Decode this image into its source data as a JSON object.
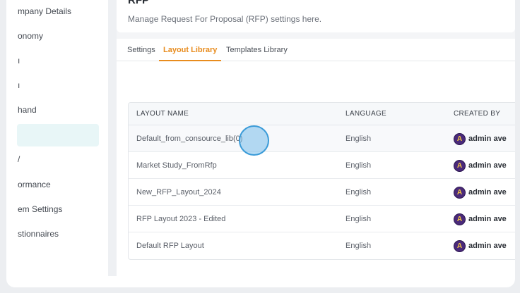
{
  "sidebar": {
    "items": [
      {
        "label": "mpany Details"
      },
      {
        "label": "onomy"
      },
      {
        "label": "ı"
      },
      {
        "label": "ı"
      },
      {
        "label": "hand"
      },
      {
        "label": ""
      },
      {
        "label": "/"
      },
      {
        "label": "ormance"
      },
      {
        "label": "em Settings"
      },
      {
        "label": "stionnaires"
      }
    ]
  },
  "header": {
    "title": "RFP",
    "subtitle": "Manage Request For Proposal (RFP) settings here."
  },
  "tabs": [
    {
      "label": "Settings"
    },
    {
      "label": "Layout Library",
      "active": true
    },
    {
      "label": "Templates Library"
    }
  ],
  "table": {
    "columns": [
      "LAYOUT NAME",
      "LANGUAGE",
      "CREATED BY"
    ],
    "rows": [
      {
        "name": "Default_from_consource_lib(0)",
        "language": "English",
        "creator": "admin ave"
      },
      {
        "name": "Market Study_FromRfp",
        "language": "English",
        "creator": "admin ave"
      },
      {
        "name": "New_RFP_Layout_2024",
        "language": "English",
        "creator": "admin ave"
      },
      {
        "name": "RFP Layout 2023 - Edited",
        "language": "English",
        "creator": "admin ave"
      },
      {
        "name": "Default RFP Layout",
        "language": "English",
        "creator": "admin ave"
      }
    ]
  },
  "colors": {
    "accent": "#e88c1e",
    "sidebar_active_bg": "#e8f6f7",
    "cursor": "#3a9bd8"
  }
}
